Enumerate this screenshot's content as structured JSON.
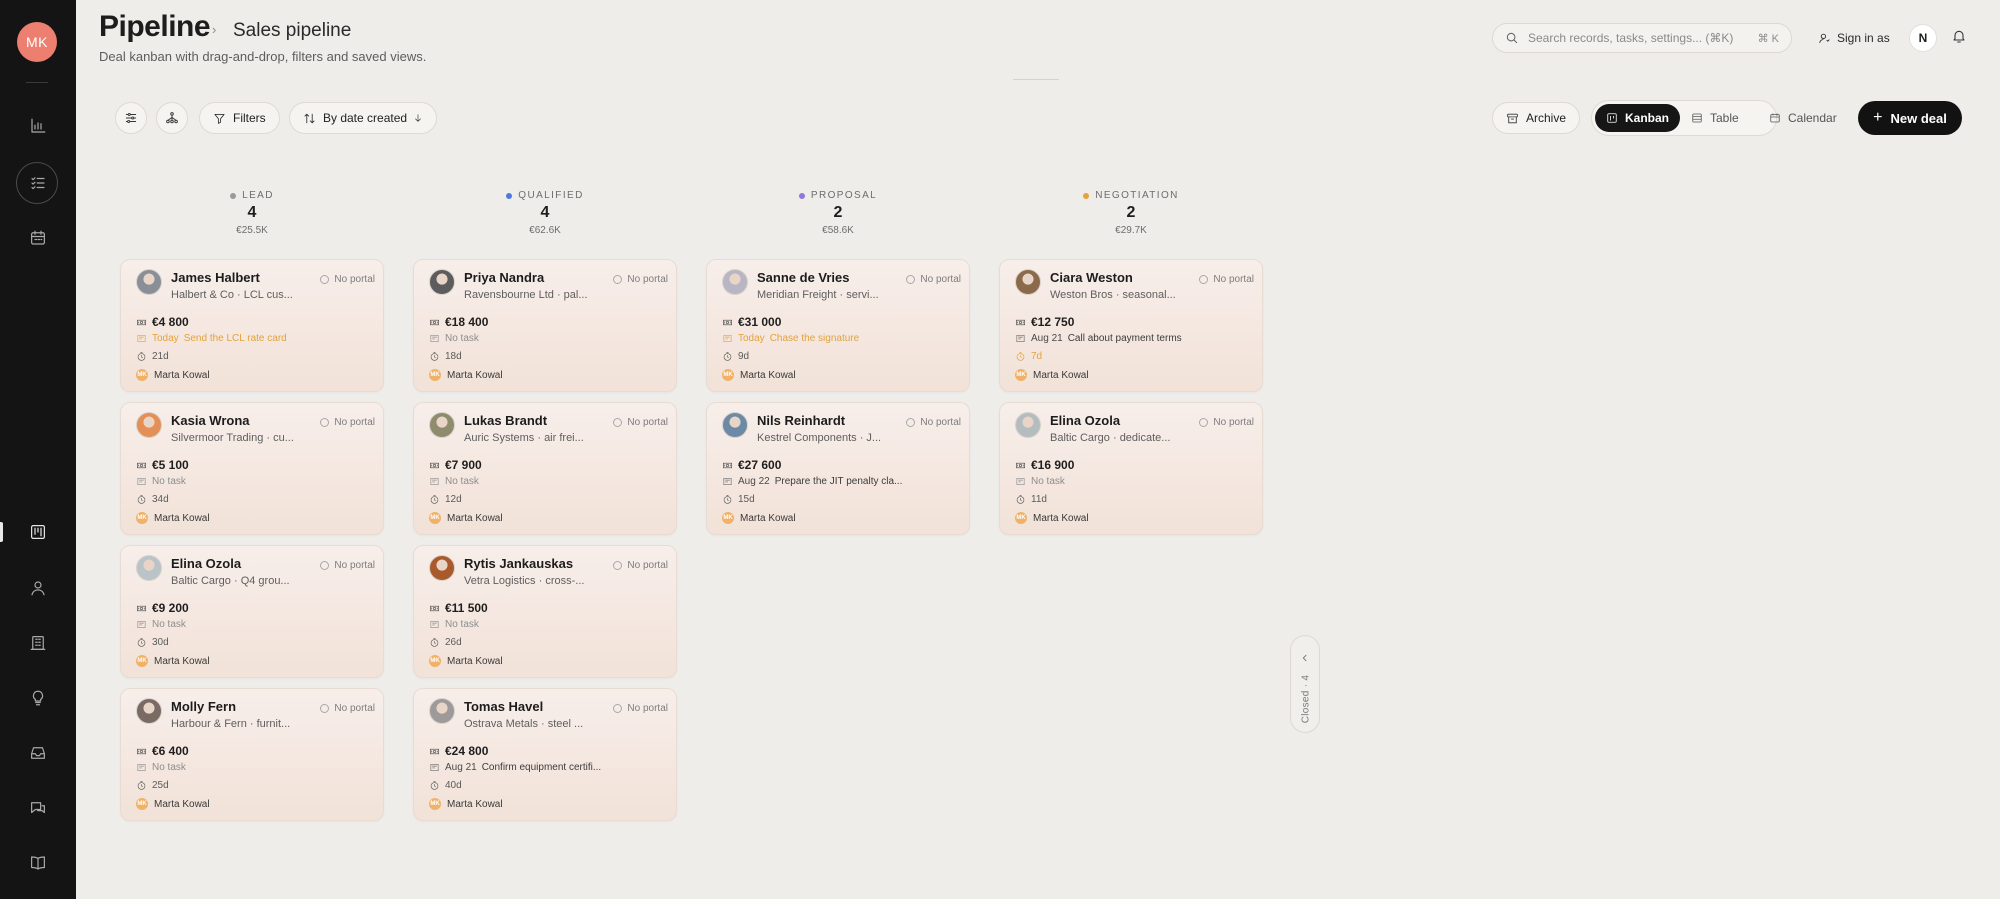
{
  "app": {
    "user_initials": "MK",
    "user_badge": "N"
  },
  "header": {
    "title": "Pipeline",
    "breadcrumb": "Sales pipeline",
    "subtitle": "Deal kanban with drag-and-drop, filters and saved views."
  },
  "search": {
    "placeholder": "Search records, tasks, settings... (⌘K)",
    "shortcut": "⌘ K"
  },
  "signin_label": "Sign in as",
  "toolbar": {
    "filters_label": "Filters",
    "sort_label": "By date created",
    "archive_label": "Archive",
    "views": [
      "Kanban",
      "Table",
      "Calendar"
    ],
    "active_view": "Kanban",
    "new_deal_label": "New deal"
  },
  "sidebar": {
    "icons": [
      "chart-icon",
      "tasks-icon",
      "calendar-icon",
      "kanban-icon",
      "person-icon",
      "building-icon",
      "lightbulb-icon",
      "inbox-icon",
      "chat-icon",
      "book-icon"
    ],
    "active": "kanban-icon"
  },
  "closed_tab": "Closed · 4",
  "colors": {
    "lead": "#9a9a9a",
    "qualified": "#4b7be0",
    "proposal": "#8f78d8",
    "negotiation": "#e6a13a",
    "today": "#e3a23c",
    "owner": "#f0b168"
  },
  "columns": [
    {
      "stage": "LEAD",
      "count": "4",
      "total": "€25.5K",
      "cards": [
        {
          "name": "James Halbert",
          "org": "Halbert & Co · LCL cus...",
          "portal": "No portal",
          "amount": "€4 800",
          "task_due": "Today",
          "task": "Send the LCL rate card",
          "task_state": "today",
          "age": "21d",
          "owner": "Marta Kowal",
          "avatar": "#8a8f97"
        },
        {
          "name": "Kasia Wrona",
          "org": "Silvermoor Trading · cu...",
          "portal": "No portal",
          "amount": "€5 100",
          "task_due": "",
          "task": "No task",
          "task_state": "none",
          "age": "34d",
          "owner": "Marta Kowal",
          "avatar": "#e38f55"
        },
        {
          "name": "Elina Ozola",
          "org": "Baltic Cargo · Q4 grou...",
          "portal": "No portal",
          "amount": "€9 200",
          "task_due": "",
          "task": "No task",
          "task_state": "none",
          "age": "30d",
          "owner": "Marta Kowal",
          "avatar": "#b9c3c8"
        },
        {
          "name": "Molly Fern",
          "org": "Harbour & Fern · furnit...",
          "portal": "No portal",
          "amount": "€6 400",
          "task_due": "",
          "task": "No task",
          "task_state": "none",
          "age": "25d",
          "owner": "Marta Kowal",
          "avatar": "#7a6a64"
        }
      ]
    },
    {
      "stage": "QUALIFIED",
      "count": "4",
      "total": "€62.6K",
      "cards": [
        {
          "name": "Priya Nandra",
          "org": "Ravensbourne Ltd · pal...",
          "portal": "No portal",
          "amount": "€18 400",
          "task_due": "",
          "task": "No task",
          "task_state": "none",
          "age": "18d",
          "owner": "Marta Kowal",
          "avatar": "#5c5c5c"
        },
        {
          "name": "Lukas Brandt",
          "org": "Auric Systems · air frei...",
          "portal": "No portal",
          "amount": "€7 900",
          "task_due": "",
          "task": "No task",
          "task_state": "none",
          "age": "12d",
          "owner": "Marta Kowal",
          "avatar": "#8e8c6c"
        },
        {
          "name": "Rytis Jankauskas",
          "org": "Vetra Logistics · cross-...",
          "portal": "No portal",
          "amount": "€11 500",
          "task_due": "",
          "task": "No task",
          "task_state": "none",
          "age": "26d",
          "owner": "Marta Kowal",
          "avatar": "#a85a2a"
        },
        {
          "name": "Tomas Havel",
          "org": "Ostrava Metals · steel ...",
          "portal": "No portal",
          "amount": "€24 800",
          "task_due": "Aug 21",
          "task": "Confirm equipment certifi...",
          "task_state": "date",
          "age": "40d",
          "owner": "Marta Kowal",
          "avatar": "#9e9a9a"
        }
      ]
    },
    {
      "stage": "PROPOSAL",
      "count": "2",
      "total": "€58.6K",
      "cards": [
        {
          "name": "Sanne de Vries",
          "org": "Meridian Freight · servi...",
          "portal": "No portal",
          "amount": "€31 000",
          "task_due": "Today",
          "task": "Chase the signature",
          "task_state": "today",
          "age": "9d",
          "owner": "Marta Kowal",
          "avatar": "#b8b6c4"
        },
        {
          "name": "Nils Reinhardt",
          "org": "Kestrel Components · J...",
          "portal": "No portal",
          "amount": "€27 600",
          "task_due": "Aug 22",
          "task": "Prepare the JIT penalty cla...",
          "task_state": "date",
          "age": "15d",
          "owner": "Marta Kowal",
          "avatar": "#6c8aa6"
        }
      ]
    },
    {
      "stage": "NEGOTIATION",
      "count": "2",
      "total": "€29.7K",
      "cards": [
        {
          "name": "Ciara Weston",
          "org": "Weston Bros · seasonal...",
          "portal": "No portal",
          "amount": "€12 750",
          "task_due": "Aug 21",
          "task": "Call about payment terms",
          "task_state": "date",
          "age": "7d",
          "age_state": "warn",
          "owner": "Marta Kowal",
          "avatar": "#8a6a4a"
        },
        {
          "name": "Elina Ozola",
          "org": "Baltic Cargo · dedicate...",
          "portal": "No portal",
          "amount": "€16 900",
          "task_due": "",
          "task": "No task",
          "task_state": "none",
          "age": "11d",
          "owner": "Marta Kowal",
          "avatar": "#b4bcc0"
        }
      ]
    }
  ]
}
